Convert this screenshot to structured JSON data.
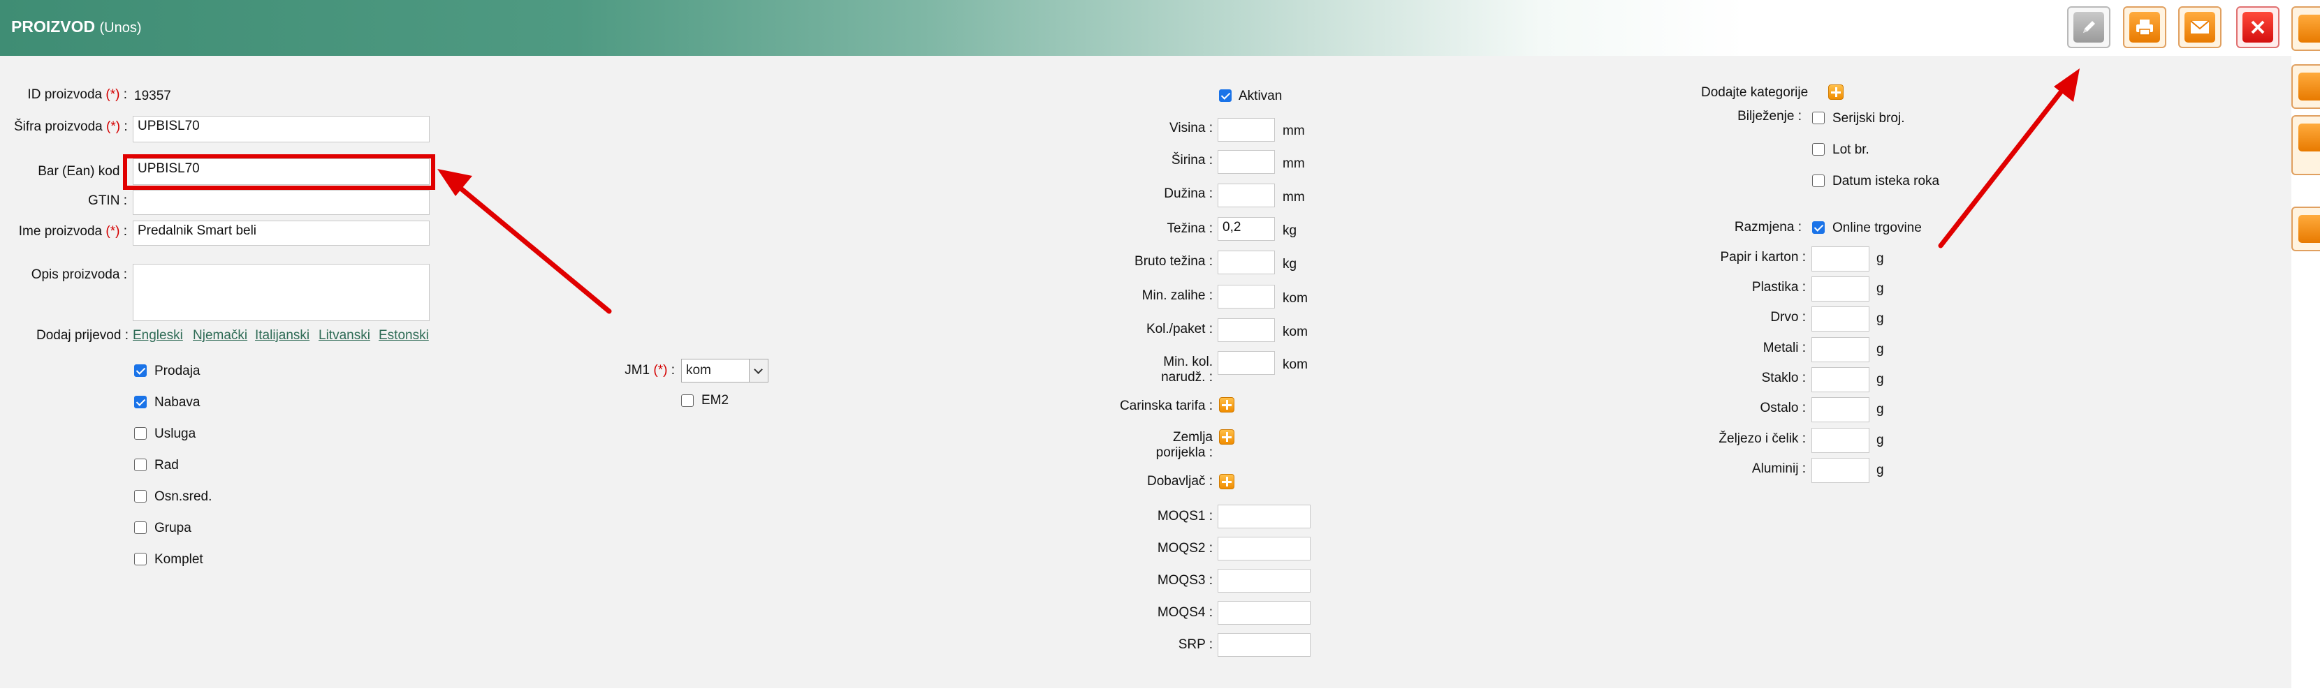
{
  "header": {
    "title": "PROIZVOD",
    "subtitle": "(Unos)"
  },
  "toolbar": {
    "edit": "edit",
    "print": "print",
    "email": "email",
    "close": "close",
    "add": "add"
  },
  "colors": {
    "header_green": "#3f8d74",
    "required": "#d40000",
    "link": "#2e6b55",
    "checkbox_checked": "#1a73e8",
    "highlight": "#e00000"
  },
  "left": {
    "id_label": "ID proizvoda",
    "id_value": "19357",
    "sifra_label": "Šifra proizvoda",
    "sifra_value": "UPBISL70",
    "bar_label": "Bar (Ean) kod",
    "bar_value": "UPBISL70",
    "gtin_label": "GTIN",
    "gtin_value": "",
    "ime_label": "Ime proizvoda",
    "ime_value": "Predalnik Smart beli",
    "opis_label": "Opis proizvoda",
    "opis_value": "",
    "req": "(*)",
    "prijevod_label": "Dodaj prijevod :",
    "languages": [
      "Engleski",
      "Njemački",
      "Italijanski",
      "Litvanski",
      "Estonski"
    ],
    "types": [
      {
        "label": "Prodaja",
        "checked": true
      },
      {
        "label": "Nabava",
        "checked": true
      },
      {
        "label": "Usluga",
        "checked": false
      },
      {
        "label": "Rad",
        "checked": false
      },
      {
        "label": "Osn.sred.",
        "checked": false
      },
      {
        "label": "Grupa",
        "checked": false
      },
      {
        "label": "Komplet",
        "checked": false
      }
    ],
    "jm1_label": "JM1",
    "jm1_value": "kom",
    "em2_label": "EM2"
  },
  "middle": {
    "aktivan": "Aktivan",
    "visina": "Visina :",
    "sirina": "Širina :",
    "duzina": "Dužina :",
    "tezina": "Težina :",
    "tezina_value": "0,2",
    "bruto": "Bruto težina :",
    "min_zalihe": "Min. zalihe :",
    "kol_paket": "Kol./paket :",
    "min_kol_1": "Min. kol.",
    "min_kol_2": "narudž. :",
    "carinska": "Carinska tarifa :",
    "zemlja_1": "Zemlja",
    "zemlja_2": "porijekla :",
    "dobavljac": "Dobavljač :",
    "moqs1": "MOQS1 :",
    "moqs2": "MOQS2 :",
    "moqs3": "MOQS3 :",
    "moqs4": "MOQS4 :",
    "srp": "SRP :",
    "mm": "mm",
    "kg": "kg",
    "kom": "kom"
  },
  "right": {
    "kategorije": "Dodajte kategorije",
    "biljezenje": "Bilježenje :",
    "serijski": "Serijski broj.",
    "lot": "Lot br.",
    "datum": "Datum isteka roka",
    "razmjena": "Razmjena :",
    "online": "Online trgovine",
    "materials": [
      {
        "label": "Papir i karton :"
      },
      {
        "label": "Plastika :"
      },
      {
        "label": "Drvo :"
      },
      {
        "label": "Metali :"
      },
      {
        "label": "Staklo :"
      },
      {
        "label": "Ostalo :"
      },
      {
        "label": "Željezo i čelik :"
      },
      {
        "label": "Aluminij :"
      }
    ],
    "g": "g"
  }
}
